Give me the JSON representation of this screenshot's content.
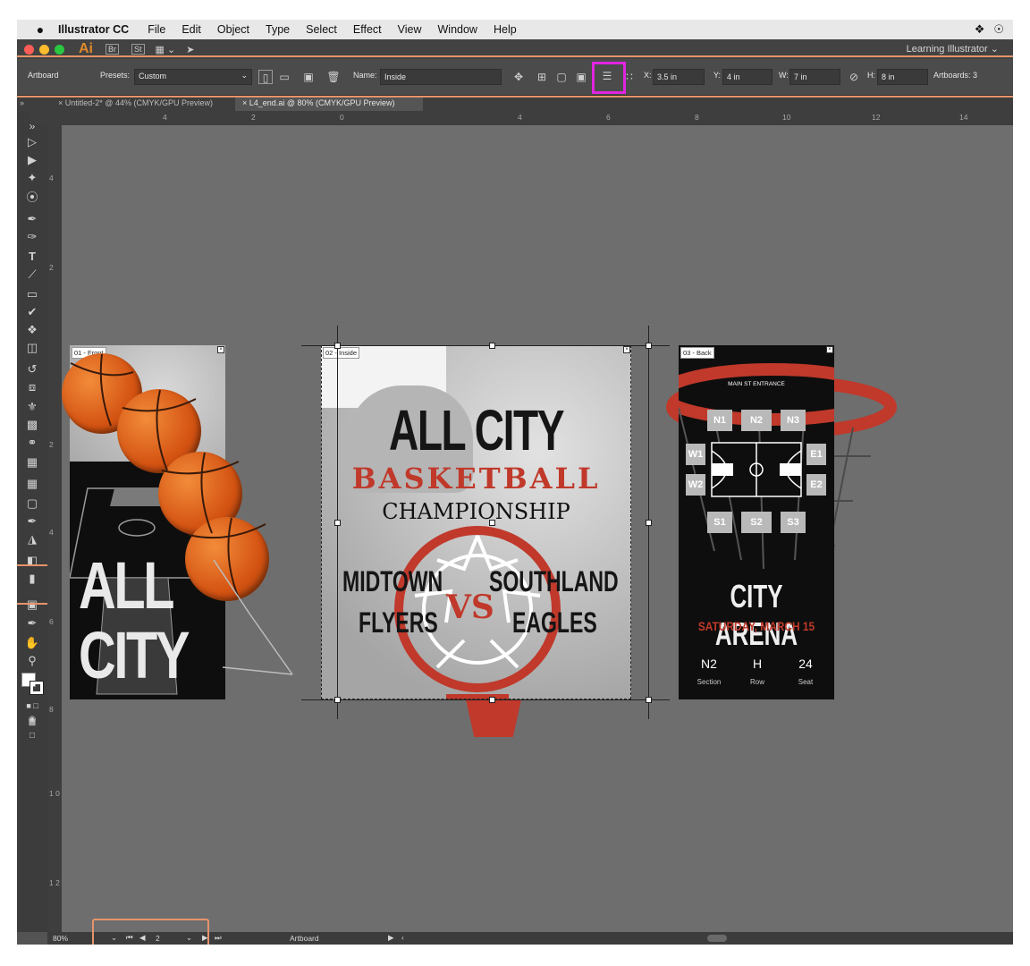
{
  "menubar": {
    "apple": "",
    "app_name": "Illustrator CC",
    "items": [
      "File",
      "Edit",
      "Object",
      "Type",
      "Select",
      "Effect",
      "View",
      "Window",
      "Help"
    ]
  },
  "appbar": {
    "logo": "Ai",
    "badges": [
      "Br",
      "St"
    ],
    "workspace": "Learning Illustrator ⌄"
  },
  "controlbar": {
    "mode_label": "Artboard",
    "presets_label": "Presets:",
    "presets_value": "Custom",
    "name_label": "Name:",
    "name_value": "Inside",
    "x_label": "X:",
    "x_value": "3.5 in",
    "y_label": "Y:",
    "y_value": "4 in",
    "w_label": "W:",
    "w_value": "7 in",
    "h_label": "H:",
    "h_value": "8 in",
    "artboards_label": "Artboards: 3"
  },
  "tabs": [
    {
      "label": "Untitled-2* @ 44% (CMYK/GPU Preview)",
      "active": false
    },
    {
      "label": "L4_end.ai @ 80% (CMYK/GPU Preview)",
      "active": true
    }
  ],
  "ruler": {
    "h_ticks": [
      "4",
      "2",
      "0",
      "2",
      "4",
      "6",
      "8",
      "10",
      "12",
      "14"
    ],
    "v_ticks": [
      "4",
      "2",
      "2",
      "4",
      "6",
      "8",
      "1 0",
      "1 2"
    ]
  },
  "artboards": {
    "front": {
      "label": "01 - Front",
      "title_line1": "ALL",
      "title_line2": "CITY"
    },
    "inside": {
      "label": "02 - Inside",
      "title": "ALL CITY",
      "subtitle": "BASKETBALL",
      "subtitle2": "CHAMPIONSHIP",
      "team1_line1": "MIDTOWN",
      "team1_line2": "FLYERS",
      "vs": "VS",
      "team2_line1": "SOUTHLAND",
      "team2_line2": "EAGLES"
    },
    "back": {
      "label": "03 - Back",
      "entrance": "MAIN ST ENTRANCE",
      "sections_n": [
        "N1",
        "N2",
        "N3"
      ],
      "sections_w": [
        "W1",
        "W2"
      ],
      "sections_e": [
        "E1",
        "E2"
      ],
      "sections_s": [
        "S1",
        "S2",
        "S3"
      ],
      "venue": "CITY ARENA",
      "date": "SATURDAY, MARCH 15",
      "ticket_values": [
        "N2",
        "H",
        "24"
      ],
      "ticket_labels": [
        "Section",
        "Row",
        "Seat"
      ]
    }
  },
  "statusbar": {
    "zoom": "80%",
    "artboard_number": "2",
    "tool_name": "Artboard"
  },
  "colors": {
    "accent_red": "#c0392b",
    "highlight_orange": "#e6936a",
    "highlight_magenta": "#e025e0"
  }
}
